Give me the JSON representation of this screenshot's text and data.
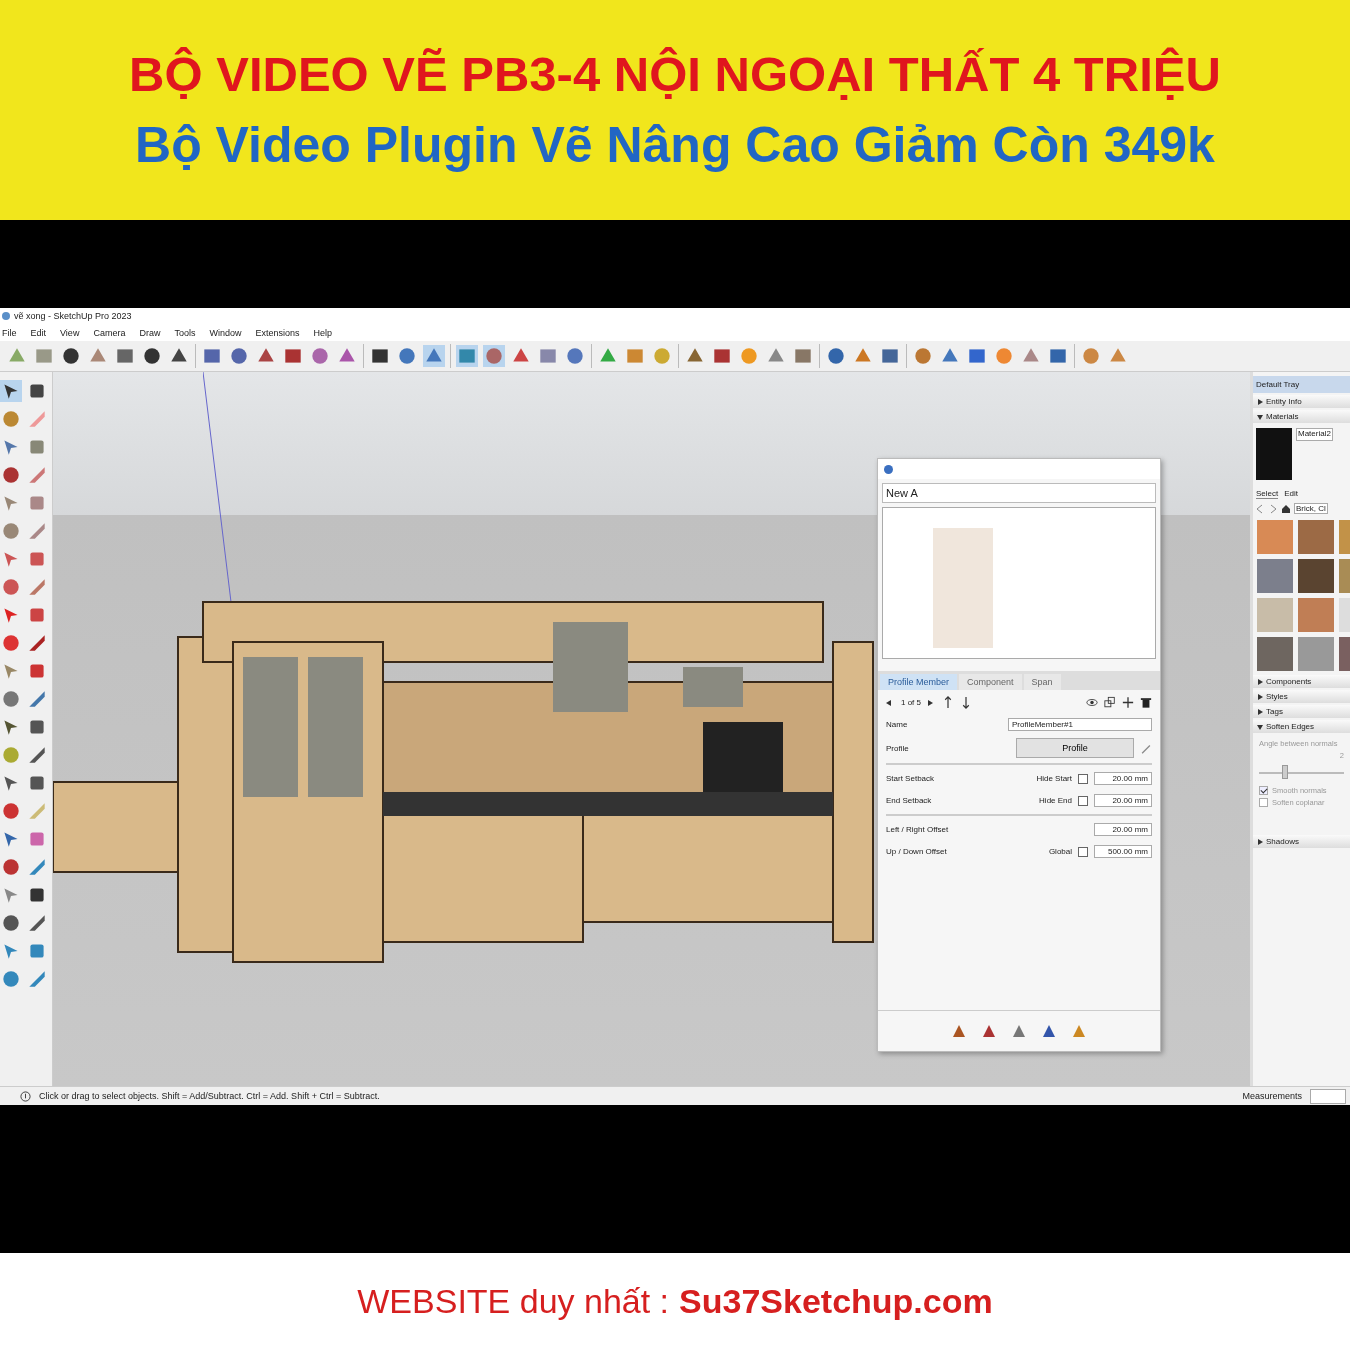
{
  "banner": {
    "headline": "BỘ VIDEO VẼ PB3-4 NỘI NGOẠI THẤT 4 TRIỆU",
    "subline": "Bộ Video Plugin Vẽ Nâng Cao Giảm Còn 349k"
  },
  "window": {
    "title": "vẽ xong - SketchUp Pro 2023"
  },
  "menu": [
    "File",
    "Edit",
    "View",
    "Camera",
    "Draw",
    "Tools",
    "Window",
    "Extensions",
    "Help"
  ],
  "assembly_panel": {
    "field_value": "New A",
    "tabs": [
      {
        "label": "Profile Member",
        "selected": true
      },
      {
        "label": "Component",
        "selected": false
      },
      {
        "label": "Span",
        "selected": false
      }
    ],
    "pager": "1 of 5",
    "name_label": "Name",
    "name_value": "ProfileMember#1",
    "profile_label": "Profile",
    "profile_button": "Profile",
    "setbacks": [
      {
        "label": "Start Setback",
        "option": "Hide Start",
        "checked": false,
        "value": "20.00 mm"
      },
      {
        "label": "End Setback",
        "option": "Hide End",
        "checked": false,
        "value": "20.00 mm"
      }
    ],
    "offsets": [
      {
        "label": "Left / Right Offset",
        "value": "20.00 mm"
      },
      {
        "label": "Up / Down Offset",
        "option": "Global",
        "checked": false,
        "value": "500.00 mm"
      }
    ]
  },
  "tray": {
    "title": "Default Tray",
    "sections_top": [
      {
        "label": "Entity Info",
        "expanded": false
      },
      {
        "label": "Materials",
        "expanded": true
      }
    ],
    "material_name": "Material2",
    "material_tabs": [
      {
        "label": "Select",
        "selected": true
      },
      {
        "label": "Edit",
        "selected": false
      }
    ],
    "library": "Brick, Cl",
    "sections_bottom": [
      {
        "label": "Components",
        "expanded": false
      },
      {
        "label": "Styles",
        "expanded": false
      },
      {
        "label": "Tags",
        "expanded": false
      },
      {
        "label": "Soften Edges",
        "expanded": true
      }
    ],
    "angle_label": "Angle between normals",
    "angle_value": "2",
    "level": 0.3,
    "options": [
      {
        "label": "Smooth normals",
        "checked": true
      },
      {
        "label": "Soften coplanar",
        "checked": false
      }
    ],
    "last_section": {
      "label": "Shadows",
      "expanded": false
    }
  },
  "status_bar": {
    "hint": "Click or drag to select objects. Shift = Add/Subtract. Ctrl = Add. Shift + Ctrl = Subtract.",
    "measurements_label": "Measurements"
  },
  "footer": {
    "label": "WEBSITE duy nhất :",
    "site": "Su37Sketchup.com"
  }
}
